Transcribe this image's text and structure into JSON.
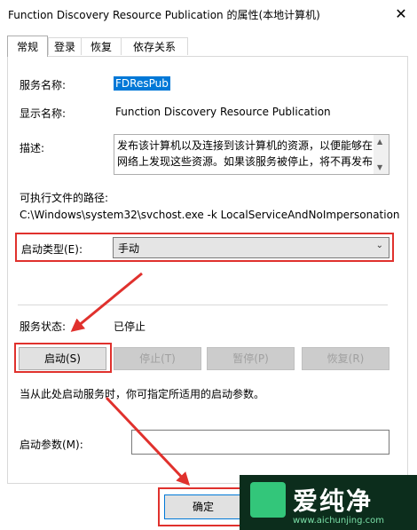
{
  "window": {
    "title": "Function Discovery Resource Publication 的属性(本地计算机)",
    "close_glyph": "✕"
  },
  "tabs": [
    {
      "label": "常规",
      "active": true
    },
    {
      "label": "登录"
    },
    {
      "label": "恢复"
    },
    {
      "label": "依存关系"
    }
  ],
  "general": {
    "service_name_label": "服务名称:",
    "service_name_value": "FDResPub",
    "display_name_label": "显示名称:",
    "display_name_value": "Function Discovery Resource Publication",
    "description_label": "描述:",
    "description_line1": "发布该计算机以及连接到该计算机的资源，以便能够在",
    "description_line2": "网络上发现这些资源。如果该服务被停止，将不再发布",
    "path_label": "可执行文件的路径:",
    "path_value": "C:\\Windows\\system32\\svchost.exe -k LocalServiceAndNoImpersonation",
    "startup_type_label": "启动类型(E):",
    "startup_type_value": "手动",
    "status_label": "服务状态:",
    "status_value": "已停止",
    "buttons": {
      "start": "启动(S)",
      "stop": "停止(T)",
      "pause": "暂停(P)",
      "resume": "恢复(R)"
    },
    "hint": "当从此处启动服务时，你可指定所适用的启动参数。",
    "params_label": "启动参数(M):"
  },
  "footer": {
    "ok_label": "确定"
  },
  "watermark": {
    "main": "爱纯净",
    "url": "www.aichunjing.com"
  },
  "colors": {
    "highlight": "#e0312d",
    "selection": "#0078d7"
  }
}
